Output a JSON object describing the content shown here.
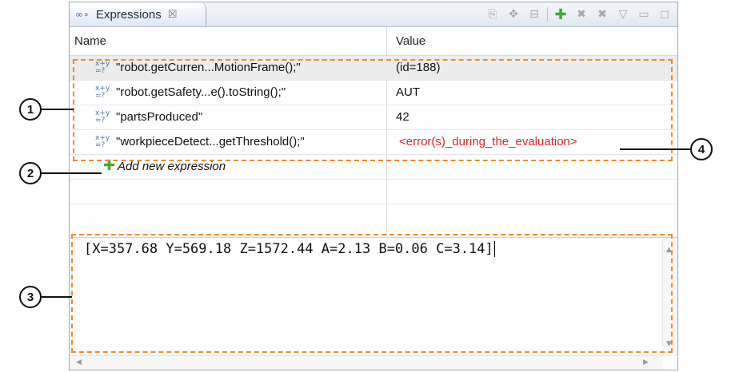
{
  "tab": {
    "title": "Expressions",
    "icon": "expressions-view-icon",
    "close": "☒"
  },
  "toolbar": [
    {
      "name": "show-type-names-icon",
      "glyph": "⎘"
    },
    {
      "name": "show-logical-structure-icon",
      "glyph": "✥"
    },
    {
      "name": "collapse-all-icon",
      "glyph": "⊟"
    },
    {
      "name": "add-watch-expression-icon",
      "glyph": "✚"
    },
    {
      "name": "remove-expression-icon",
      "glyph": "✖"
    },
    {
      "name": "remove-all-expressions-icon",
      "glyph": "✖"
    },
    {
      "name": "view-menu-icon",
      "glyph": "▽"
    },
    {
      "name": "minimize-icon",
      "glyph": "▭"
    },
    {
      "name": "maximize-icon",
      "glyph": "◻"
    }
  ],
  "columns": {
    "name": "Name",
    "value": "Value"
  },
  "expressions": [
    {
      "name": "\"robot.getCurren...MotionFrame();\"",
      "value": " (id=188)",
      "error": false
    },
    {
      "name": "\"robot.getSafety...e().toString();\"",
      "value": "AUT",
      "error": false
    },
    {
      "name": "\"partsProduced\"",
      "value": "42",
      "error": false
    },
    {
      "name": "\"workpieceDetect...getThreshold();\"",
      "value": "<error(s)_during_the_evaluation>",
      "error": true
    }
  ],
  "expression_icon_text": "x+y\n=?",
  "add_new": "Add new expression",
  "detail": {
    "text": "[X=357.68 Y=569.18 Z=1572.44 A=2.13 B=0.06 C=3.14]"
  },
  "callouts": [
    "1",
    "2",
    "3",
    "4"
  ],
  "colors": {
    "highlight": "#ef8a2b",
    "error": "#e0222b",
    "add_icon": "#4caa3a"
  }
}
